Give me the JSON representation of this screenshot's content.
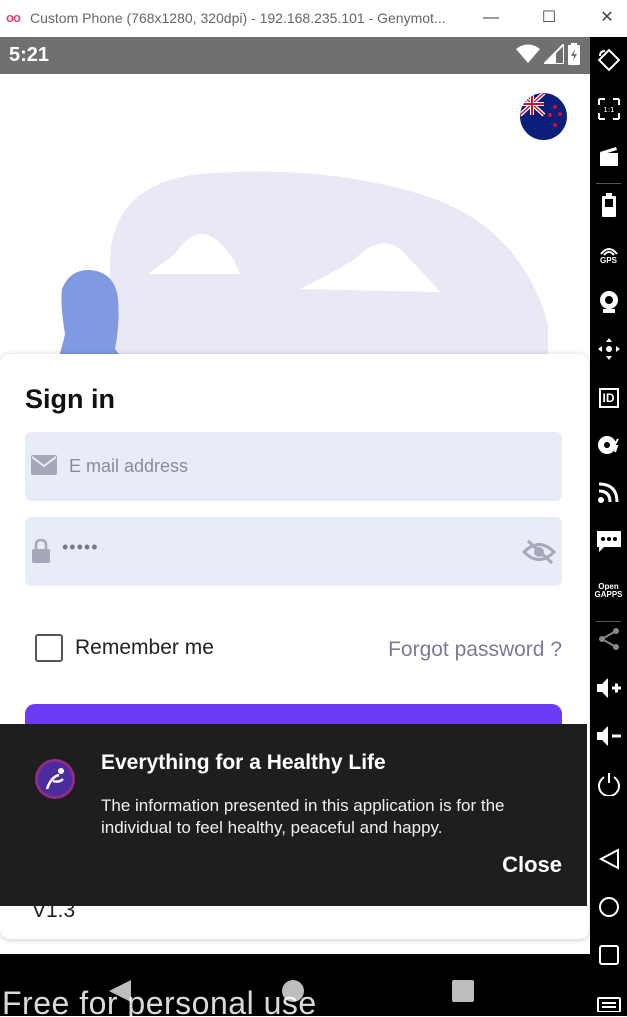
{
  "window": {
    "title": "Custom Phone (768x1280, 320dpi) - 192.168.235.101 - Genymot...",
    "logo": "oo",
    "minimize": "—",
    "maximize": "☐",
    "close": "✕"
  },
  "status_bar": {
    "time": "5:21"
  },
  "login": {
    "title": "Sign in",
    "email_placeholder": "E mail address",
    "password_masked": "•••••",
    "remember_label": "Remember me",
    "forgot_label": "Forgot password ?",
    "version": "V1.3"
  },
  "toast": {
    "title": "Everything for a Healthy Life",
    "body": "The information presented in this application is for the individual to feel healthy, peaceful and happy.",
    "close_label": "Close"
  },
  "watermark": "Free for personal use",
  "sidebar": {
    "gps_label": "GPS",
    "id_label": "ID",
    "opengapps_label": "Open GAPPS",
    "scale_label": "1:1"
  },
  "colors": {
    "primary": "#6b3bf5",
    "field_bg": "#e8ecf7",
    "toast_bg": "#1e1e1e",
    "status_bar": "#707070"
  }
}
